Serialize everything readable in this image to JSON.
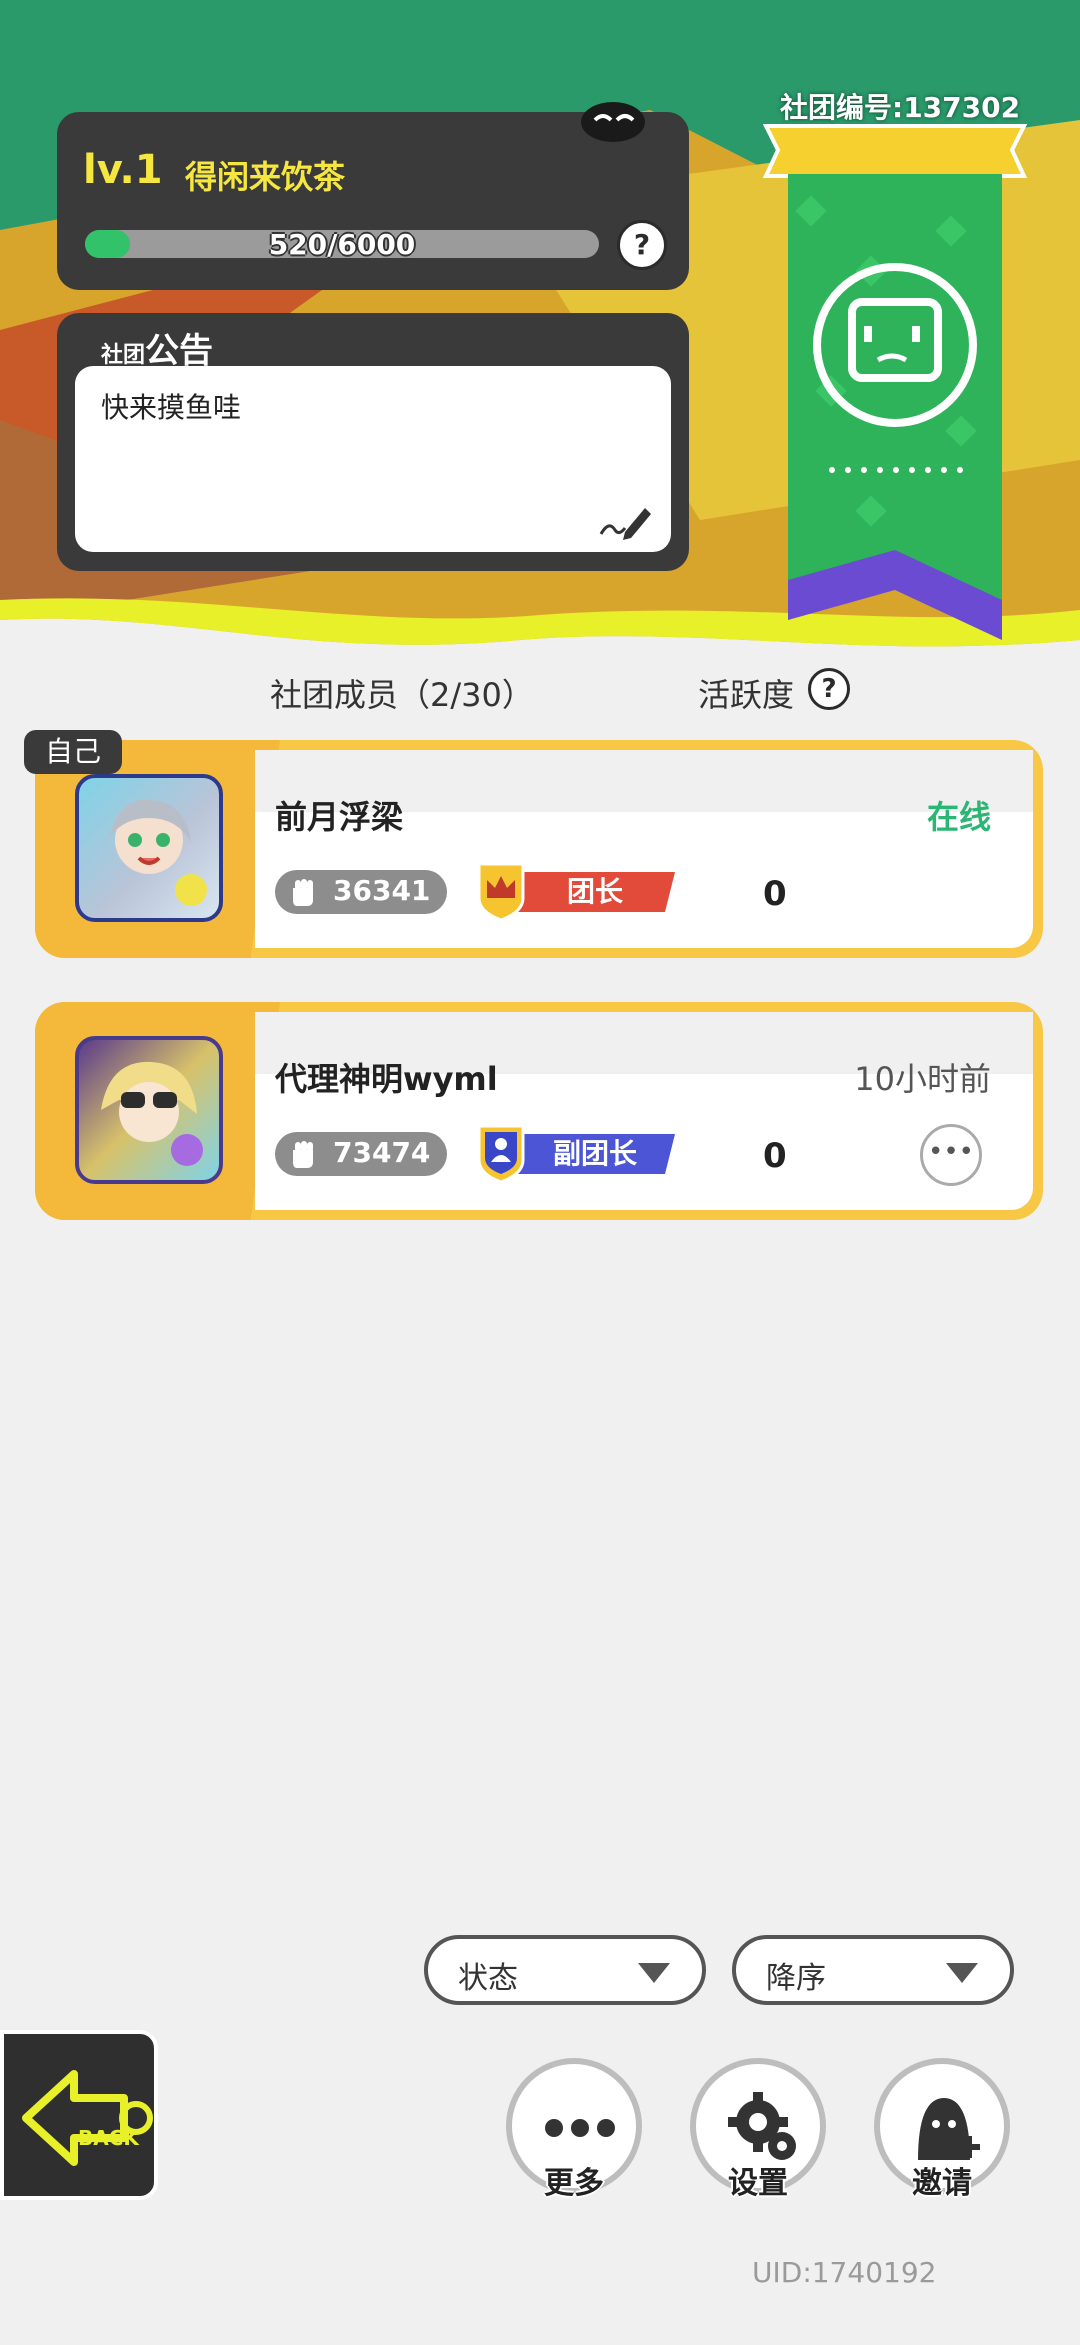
{
  "club": {
    "level": "lv.1",
    "name": "得闲来饮茶",
    "exp_text": "520/6000",
    "exp_current": 520,
    "exp_max": 6000,
    "id_text": "社团编号:137302"
  },
  "notice": {
    "title_small": "社团",
    "title_big": "公告",
    "text": "快来摸鱼哇"
  },
  "members_header": {
    "count_label": "社团成员（2/30）",
    "activity_label": "活跃度",
    "help_icon": "?"
  },
  "members": [
    {
      "self_tag": "自己",
      "name": "前月浮梁",
      "status": "在线",
      "status_color": "#2bb673",
      "power": "36341",
      "role": "团长",
      "role_color": "#e24a3a",
      "activity": "0"
    },
    {
      "name": "代理神明wyml",
      "status": "10小时前",
      "status_color": "#555555",
      "power": "73474",
      "role": "副团长",
      "role_color": "#4b55d6",
      "activity": "0",
      "more": "•••"
    }
  ],
  "filters": {
    "status": "状态",
    "order": "降序"
  },
  "actions": {
    "more": "更多",
    "settings": "设置",
    "invite": "邀请",
    "dots": "•••"
  },
  "back_label": "BACK",
  "uid": "UID:1740192",
  "colors": {
    "banner_green": "#2fb35a",
    "accent_yellow": "#e8f02a",
    "banner_purple": "#6b4bd1"
  }
}
